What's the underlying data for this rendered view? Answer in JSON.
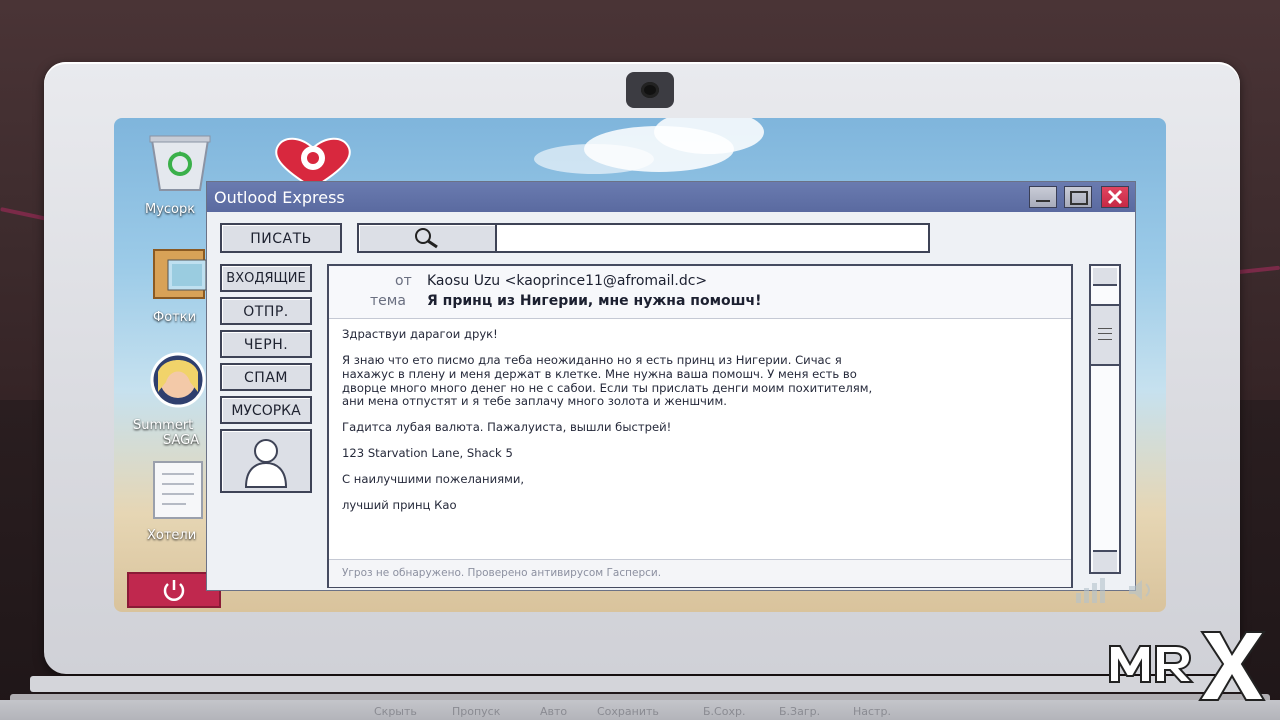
{
  "desktop": {
    "icons": [
      {
        "name": "trash",
        "label": "Мусорк"
      },
      {
        "name": "dating-app",
        "label": ""
      },
      {
        "name": "photos",
        "label": "Фотки"
      },
      {
        "name": "summertime-saga",
        "label_line1": "Summert",
        "label_line2": "SAGA"
      },
      {
        "name": "hotels",
        "label": "Хотели"
      }
    ]
  },
  "window": {
    "title": "Outlood Express",
    "compose_label": "ПИСАТЬ",
    "search_value": "",
    "folders": [
      "ВХОДЯЩИЕ",
      "ОТПР.",
      "ЧЕРН.",
      "СПАМ",
      "МУСОРКА"
    ]
  },
  "email": {
    "from_label": "от",
    "from": "Kaosu Uzu <kaoprince11@afromail.dc>",
    "subject_label": "тема",
    "subject": "Я принц из Нигерии, мне нужна помошч!",
    "body": [
      "Здраствуи дарагои друк!",
      "Я знаю что ето писмо дла теба неожиданно но я есть принц из Нигерии. Сичас я",
      "нахажус в плену и меня держат в клетке. Мне нужна ваша помошч. У меня есть во",
      "дворце много много денег но не с сабои. Если ты прислать денги моим похитителям,",
      "ани мена отпустят и я тебе заплачу много золота и женшчим.",
      "Гадитса лубая валюта. Пажалуиста, вышли быстрей!",
      "123 Starvation Lane, Shack 5",
      "С наилучшими пожеланиями,",
      "лучший принц Као"
    ],
    "status": "Угроз не обнаружено. Проверено антивирусом Гасперси."
  },
  "game_menu": [
    "Скрыть",
    "Пропуск",
    "Авто",
    "Сохранить",
    "Б.Сохр.",
    "Б.Загр.",
    "Настр."
  ],
  "watermark": "MR X",
  "colors": {
    "titlebar": "#5f6fa6",
    "close_button": "#d3344f",
    "power_button": "#c0284e"
  }
}
